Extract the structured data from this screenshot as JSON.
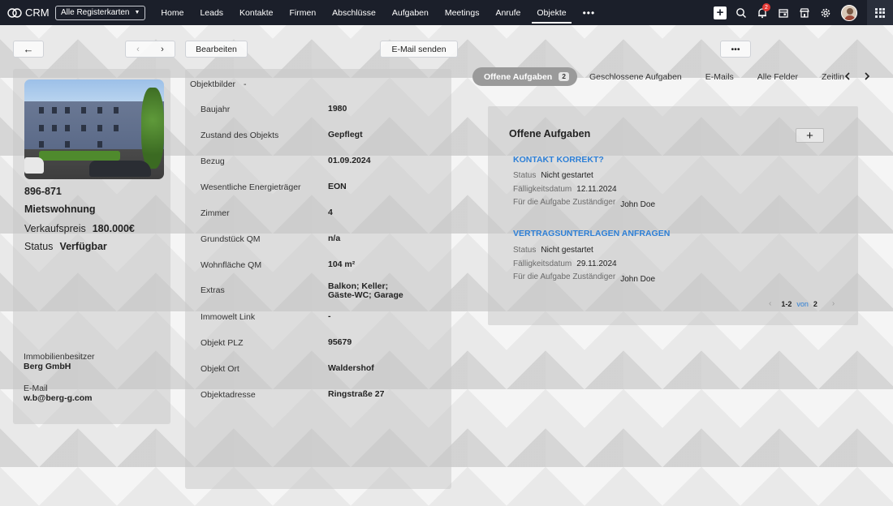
{
  "topbar": {
    "app_name": "CRM",
    "tabs_select": "Alle Registerkarten",
    "nav": [
      "Home",
      "Leads",
      "Kontakte",
      "Firmen",
      "Abschlüsse",
      "Aufgaben",
      "Meetings",
      "Anrufe",
      "Objekte"
    ],
    "active_nav": "Objekte",
    "more": "•••",
    "notification_count": "2"
  },
  "toolbar": {
    "back": "←",
    "edit_label": "Bearbeiten",
    "email_label": "E-Mail senden",
    "more_label": "•••"
  },
  "record": {
    "code": "896-871",
    "type": "Mietswohnung",
    "price_label": "Verkaufspreis",
    "price_value": "180.000€",
    "status_label": "Status",
    "status_value": "Verfügbar",
    "owner_label": "Immobilienbesitzer",
    "owner_value": "Berg GmbH",
    "email_label": "E-Mail",
    "email_value": "w.b@berg-g.com"
  },
  "details": {
    "images_label": "Objektbilder",
    "images_value": "-",
    "fields": [
      {
        "label": "Baujahr",
        "value": "1980"
      },
      {
        "label": "Zustand des Objekts",
        "value": "Gepflegt"
      },
      {
        "label": "Bezug",
        "value": "01.09.2024"
      },
      {
        "label": "Wesentliche Energieträger",
        "value": "EON"
      },
      {
        "label": "Zimmer",
        "value": "4"
      },
      {
        "label": "Grundstück QM",
        "value": "n/a"
      },
      {
        "label": "Wohnfläche QM",
        "value": "104 m²"
      },
      {
        "label": "Extras",
        "value": "Balkon; Keller; Gäste-WC; Garage"
      },
      {
        "label": "Immowelt Link",
        "value": "-"
      },
      {
        "label": "Objekt PLZ",
        "value": "95679"
      },
      {
        "label": "Objekt Ort",
        "value": "Waldershof"
      },
      {
        "label": "Objektadresse",
        "value": "Ringstraße 27"
      }
    ]
  },
  "related_tabs": {
    "active": "Offene Aufgaben",
    "active_count": "2",
    "others": [
      "Geschlossene Aufgaben",
      "E-Mails",
      "Alle Felder",
      "Zeitlin"
    ]
  },
  "tasks": {
    "title": "Offene Aufgaben",
    "add": "+",
    "items": [
      {
        "name": "KONTAKT KORREKT?",
        "status_label": "Status",
        "status": "Nicht gestartet",
        "due_label": "Fälligkeitsdatum",
        "due": "12.11.2024",
        "owner_label": "Für die Aufgabe Zuständiger",
        "owner": "John Doe"
      },
      {
        "name": "VERTRAGSUNTERLAGEN ANFRAGEN",
        "status_label": "Status",
        "status": "Nicht gestartet",
        "due_label": "Fälligkeitsdatum",
        "due": "29.11.2024",
        "owner_label": "Für die Aufgabe Zuständiger",
        "owner": "John Doe"
      }
    ],
    "pager_range": "1-2",
    "pager_of": "von",
    "pager_total": "2"
  }
}
